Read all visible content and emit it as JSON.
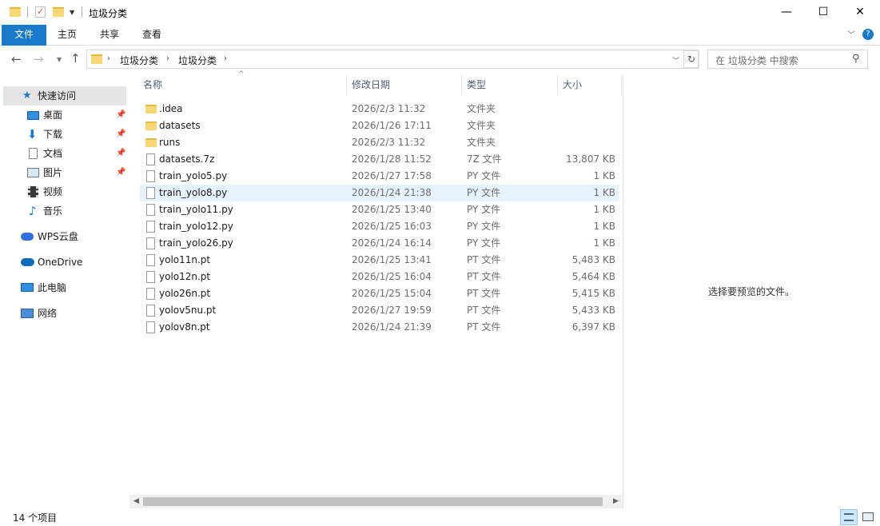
{
  "window": {
    "title": "垃圾分类",
    "controls": {
      "minimize": "—",
      "maximize": "☐",
      "close": "✕"
    }
  },
  "ribbon": {
    "tabs": [
      "文件",
      "主页",
      "共享",
      "查看"
    ]
  },
  "address": {
    "crumbs": [
      "垃圾分类",
      "垃圾分类"
    ],
    "search_placeholder": "在 垃圾分类 中搜索"
  },
  "nav": {
    "quick_access": "快速访问",
    "items": [
      {
        "label": "桌面",
        "icon": "desktop-icon",
        "pinned": true
      },
      {
        "label": "下载",
        "icon": "download-icon",
        "pinned": true
      },
      {
        "label": "文档",
        "icon": "document-icon",
        "pinned": true
      },
      {
        "label": "图片",
        "icon": "picture-icon",
        "pinned": true
      },
      {
        "label": "视频",
        "icon": "video-icon",
        "pinned": false
      },
      {
        "label": "音乐",
        "icon": "music-icon",
        "pinned": false
      }
    ],
    "wps": "WPS云盘",
    "onedrive": "OneDrive",
    "pc": "此电脑",
    "network": "网络"
  },
  "columns": {
    "name": "名称",
    "date": "修改日期",
    "type": "类型",
    "size": "大小"
  },
  "files": [
    {
      "name": ".idea",
      "date": "2026/2/3 11:32",
      "type": "文件夹",
      "size": "",
      "kind": "folder"
    },
    {
      "name": "datasets",
      "date": "2026/1/26 17:11",
      "type": "文件夹",
      "size": "",
      "kind": "folder"
    },
    {
      "name": "runs",
      "date": "2026/2/3 11:32",
      "type": "文件夹",
      "size": "",
      "kind": "folder"
    },
    {
      "name": "datasets.7z",
      "date": "2026/1/28 11:52",
      "type": "7Z 文件",
      "size": "13,807 KB",
      "kind": "file"
    },
    {
      "name": "train_yolo5.py",
      "date": "2026/1/27 17:58",
      "type": "PY 文件",
      "size": "1 KB",
      "kind": "file"
    },
    {
      "name": "train_yolo8.py",
      "date": "2026/1/24 21:38",
      "type": "PY 文件",
      "size": "1 KB",
      "kind": "file"
    },
    {
      "name": "train_yolo11.py",
      "date": "2026/1/25 13:40",
      "type": "PY 文件",
      "size": "1 KB",
      "kind": "file"
    },
    {
      "name": "train_yolo12.py",
      "date": "2026/1/25 16:03",
      "type": "PY 文件",
      "size": "1 KB",
      "kind": "file"
    },
    {
      "name": "train_yolo26.py",
      "date": "2026/1/24 16:14",
      "type": "PY 文件",
      "size": "1 KB",
      "kind": "file"
    },
    {
      "name": "yolo11n.pt",
      "date": "2026/1/25 13:41",
      "type": "PT 文件",
      "size": "5,483 KB",
      "kind": "file"
    },
    {
      "name": "yolo12n.pt",
      "date": "2026/1/25 16:04",
      "type": "PT 文件",
      "size": "5,464 KB",
      "kind": "file"
    },
    {
      "name": "yolo26n.pt",
      "date": "2026/1/25 15:04",
      "type": "PT 文件",
      "size": "5,415 KB",
      "kind": "file"
    },
    {
      "name": "yolov5nu.pt",
      "date": "2026/1/27 19:59",
      "type": "PT 文件",
      "size": "5,433 KB",
      "kind": "file"
    },
    {
      "name": "yolov8n.pt",
      "date": "2026/1/24 21:39",
      "type": "PT 文件",
      "size": "6,397 KB",
      "kind": "file"
    }
  ],
  "hovered_row": 5,
  "preview": {
    "message": "选择要预览的文件。"
  },
  "status": {
    "count": "14 个项目"
  },
  "colors": {
    "accent": "#1979ca",
    "folder": "#f8d775",
    "hover": "#e5f3ff",
    "selected_nav": "#e5e5e5"
  }
}
